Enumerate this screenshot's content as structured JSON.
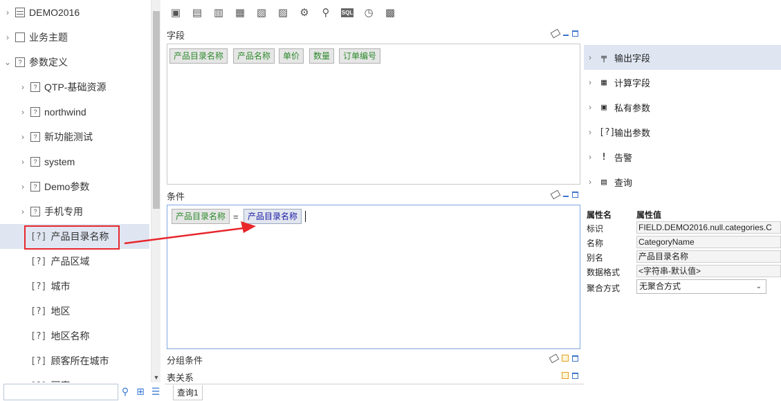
{
  "left_tree": {
    "items": [
      {
        "label": "DEMO2016",
        "arrow": "›",
        "icon": "db"
      },
      {
        "label": "业务主题",
        "arrow": "›",
        "icon": "doc"
      },
      {
        "label": "参数定义",
        "arrow": "⌄",
        "icon": "q"
      },
      {
        "label": "QTP-基础资源",
        "arrow": "›",
        "icon": "q"
      },
      {
        "label": "northwind",
        "arrow": "›",
        "icon": "q"
      },
      {
        "label": "新功能测试",
        "arrow": "›",
        "icon": "q"
      },
      {
        "label": "system",
        "arrow": "›",
        "icon": "q"
      },
      {
        "label": "Demo参数",
        "arrow": "›",
        "icon": "q"
      },
      {
        "label": "手机专用",
        "arrow": "›",
        "icon": "q"
      },
      {
        "label": "产品目录名称",
        "icon": "param",
        "selected": true
      },
      {
        "label": "产品区域",
        "icon": "param"
      },
      {
        "label": "城市",
        "icon": "param"
      },
      {
        "label": "地区",
        "icon": "param"
      },
      {
        "label": "地区名称",
        "icon": "param"
      },
      {
        "label": "顾客所在城市",
        "icon": "param"
      },
      {
        "label": "国家",
        "icon": "param"
      }
    ],
    "param_glyph": "[?]"
  },
  "search": {
    "value": ""
  },
  "sections": {
    "fields_title": "字段",
    "conditions_title": "条件",
    "group_conditions_title": "分组条件",
    "table_relations_title": "表关系"
  },
  "field_chips": [
    "产品目录名称",
    "产品名称",
    "单价",
    "数量",
    "订单编号"
  ],
  "condition": {
    "left": "产品目录名称",
    "operator": "=",
    "right": "产品目录名称"
  },
  "tabs": [
    {
      "label": "查询1"
    }
  ],
  "right_tree": {
    "items": [
      {
        "label": "输出字段",
        "icon": "╤",
        "selected": true
      },
      {
        "label": "计算字段",
        "icon": "▦"
      },
      {
        "label": "私有参数",
        "icon": "▣"
      },
      {
        "label": "输出参数",
        "icon": "[?]"
      },
      {
        "label": "告警",
        "icon": "!"
      },
      {
        "label": "查询",
        "icon": "▤"
      }
    ]
  },
  "properties": {
    "header_name": "属性名",
    "header_value": "属性值",
    "rows": [
      {
        "label": "标识",
        "value": "FIELD.DEMO2016.null.categories.C"
      },
      {
        "label": "名称",
        "value": "CategoryName"
      },
      {
        "label": "别名",
        "value": "产品目录名称"
      },
      {
        "label": "数据格式",
        "value": "<字符串-默认值>"
      },
      {
        "label": "聚合方式",
        "value": "无聚合方式"
      }
    ]
  },
  "colors": {
    "accent": "#3b74c9",
    "highlight": "#e8262c",
    "selected_bg": "#dfe6f2",
    "field_text": "#2d8a2d"
  }
}
